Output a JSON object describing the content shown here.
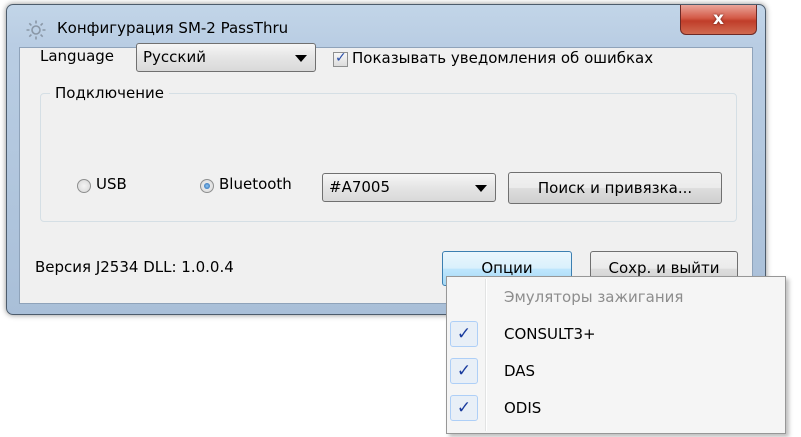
{
  "window": {
    "title": "Конфигурация SM-2 PassThru",
    "close_glyph": "x",
    "icon": "gear-icon"
  },
  "language": {
    "label": "Language",
    "selected": "Русский"
  },
  "notify_errors": {
    "label": "Показывать уведомления об ошибках",
    "checked": true
  },
  "connection": {
    "group_title": "Подключение",
    "usb_label": "USB",
    "usb_selected": false,
    "bluetooth_label": "Bluetooth",
    "bluetooth_selected": true,
    "device_selected": "#A7005",
    "search_button": "Поиск и привязка..."
  },
  "footer": {
    "version_text": "Версия J2534 DLL: 1.0.0.4",
    "options_button": "Опции",
    "save_exit_button": "Сохр. и выйти"
  },
  "options_menu": {
    "items": [
      {
        "label": "Эмуляторы зажигания",
        "checked": false,
        "enabled": false
      },
      {
        "label": "CONSULT3+",
        "checked": true,
        "enabled": true
      },
      {
        "label": "DAS",
        "checked": true,
        "enabled": true
      },
      {
        "label": "ODIS",
        "checked": true,
        "enabled": true
      }
    ]
  },
  "colors": {
    "close_button": "#c8503a",
    "check_mark": "#1a3c9e",
    "focus_button_border": "#3c7fb1"
  }
}
